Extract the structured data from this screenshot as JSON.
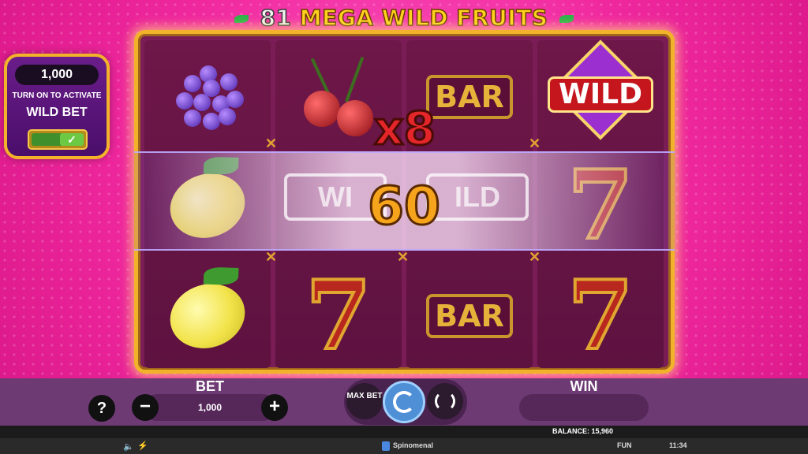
{
  "game": {
    "title_number": "81",
    "title_text": "MEGA WILD FRUITS"
  },
  "wild_bet_panel": {
    "amount": "1,000",
    "line1": "TURN ON TO ACTIVATE",
    "line2": "WILD BET",
    "toggle_state": "on"
  },
  "reels": [
    [
      "grapes",
      "lemon",
      "lemon"
    ],
    [
      "cherries",
      "wild",
      "seven"
    ],
    [
      "bar",
      "wild",
      "bar"
    ],
    [
      "wild",
      "seven",
      "seven"
    ]
  ],
  "symbols": {
    "bar": "BAR",
    "wild": "WILD",
    "seven": "7"
  },
  "win_overlay": {
    "multiplier": "x8",
    "amount": "60",
    "ghost_wild_1": "WI",
    "ghost_wild_2": "ILD"
  },
  "controls": {
    "help": "?",
    "bet_label": "BET",
    "bet_value": "1,000",
    "minus": "−",
    "plus": "+",
    "max_bet": "MAX BET",
    "win_label": "WIN",
    "win_value": ""
  },
  "status": {
    "balance": "BALANCE: 15,960",
    "brand": "Spinomenal",
    "mode": "FUN",
    "time": "11:34"
  },
  "colors": {
    "background": "#f0289e",
    "frame_gold": "#f2b22a",
    "reel_bg": "#6e1749",
    "control_bar": "#6d3a73"
  }
}
